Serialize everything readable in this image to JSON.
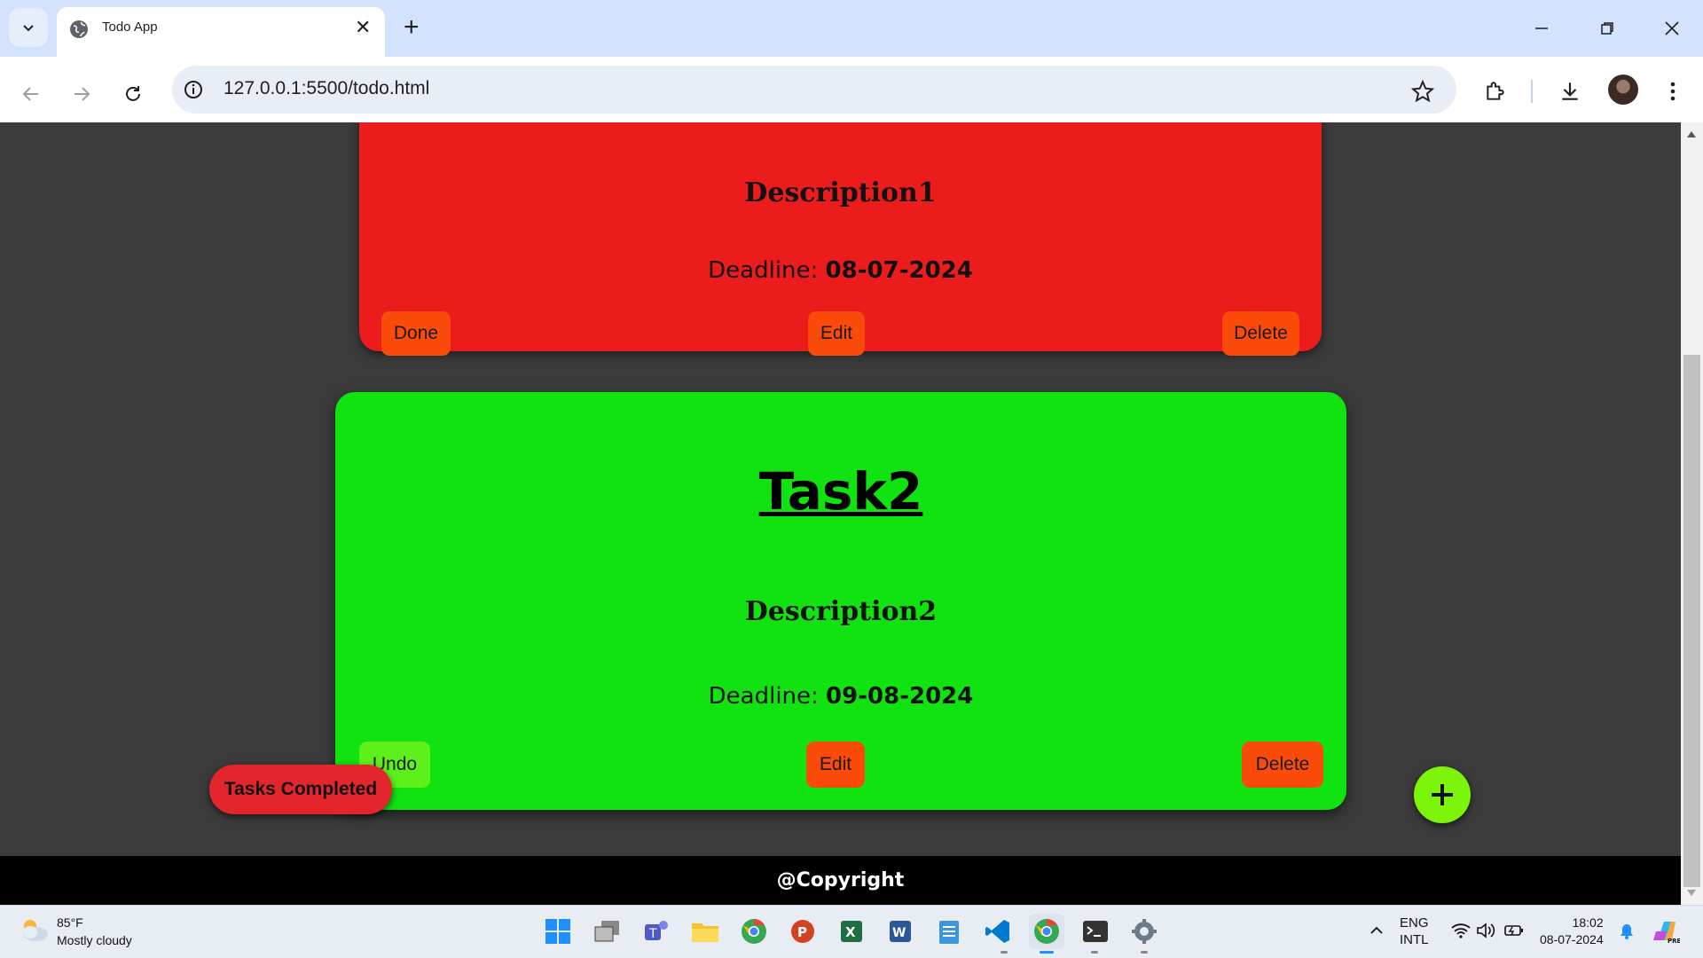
{
  "browser": {
    "tab_title": "Todo App",
    "url": "127.0.0.1:5500/todo.html"
  },
  "tasks": [
    {
      "description": "Description1",
      "deadline_label": "Deadline:",
      "deadline_value": "08-07-2024",
      "status_button": "Done",
      "edit_button": "Edit",
      "delete_button": "Delete",
      "color": "#ec1c1c"
    },
    {
      "title": "Task2",
      "description": "Description2",
      "deadline_label": "Deadline:",
      "deadline_value": "09-08-2024",
      "status_button": "Undo",
      "edit_button": "Edit",
      "delete_button": "Delete",
      "color": "#11e311"
    }
  ],
  "tasks_completed_button": "Tasks Completed",
  "add_button_icon": "plus-icon",
  "footer": "@Copyright",
  "taskbar": {
    "weather_temp": "85°F",
    "weather_desc": "Mostly cloudy",
    "lang_1": "ENG",
    "lang_2": "INTL",
    "time": "18:02",
    "date": "08-07-2024"
  }
}
